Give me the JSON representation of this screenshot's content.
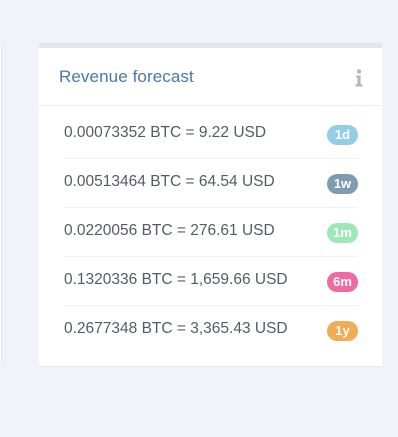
{
  "card": {
    "title": "Revenue forecast",
    "info_icon": "info-icon"
  },
  "forecast": [
    {
      "text": "0.00073352 BTC = 9.22 USD",
      "badge": "1d",
      "color": "#93cde8"
    },
    {
      "text": "0.00513464 BTC = 64.54 USD",
      "badge": "1w",
      "color": "#7f9bb0"
    },
    {
      "text": "0.0220056 BTC = 276.61 USD",
      "badge": "1m",
      "color": "#9ee8b8"
    },
    {
      "text": "0.1320336 BTC = 1,659.66 USD",
      "badge": "6m",
      "color": "#ee6aa0"
    },
    {
      "text": "0.2677348 BTC = 3,365.43 USD",
      "badge": "1y",
      "color": "#f2ab57"
    }
  ],
  "colors": {
    "accent": "#4a78a8",
    "background": "#f2f3f8"
  }
}
